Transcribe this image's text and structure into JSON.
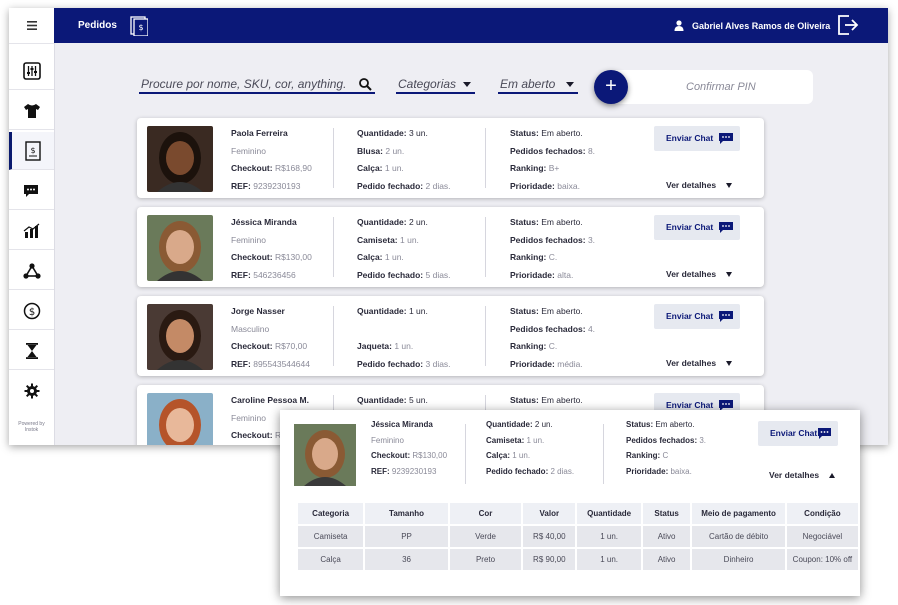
{
  "sidebar": {
    "items": [
      {
        "icon": "hamburger-menu-icon"
      },
      {
        "icon": "sliders-icon"
      },
      {
        "icon": "tshirt-icon"
      },
      {
        "icon": "order-receipt-icon",
        "active": true
      },
      {
        "icon": "chat-icon"
      },
      {
        "icon": "bar-chart-icon"
      },
      {
        "icon": "network-icon"
      },
      {
        "icon": "dollar-icon"
      },
      {
        "icon": "hourglass-icon"
      },
      {
        "icon": "gear-icon"
      }
    ],
    "powered_line1": "Powered by",
    "powered_line2": "Instok"
  },
  "header": {
    "title": "Pedidos",
    "user_name": "Gabriel Alves Ramos de Oliveira"
  },
  "filters": {
    "search_placeholder": "Procure por nome, SKU, cor, anything.",
    "category": "Categorias",
    "status": "Em aberto",
    "add_label": "+",
    "pin_label": "Confirmar PIN"
  },
  "orders": [
    {
      "name": "Paola Ferreira",
      "gender": "Feminino",
      "checkout_label": "Checkout:",
      "checkout": "R$168,90",
      "ref_label": "REF:",
      "ref": "9239230193",
      "qty_label": "Quantidade:",
      "qty": "3 un.",
      "line2_label": "Blusa:",
      "line2": "2 un.",
      "line3_label": "Calça:",
      "line3": "1 un.",
      "line4_label": "Pedido fechado:",
      "line4": "2 dias.",
      "status_label": "Status:",
      "status": "Em aberto.",
      "closed_label": "Pedidos fechados:",
      "closed": "8.",
      "ranking_label": "Ranking:",
      "ranking": "B+",
      "priority_label": "Prioridade:",
      "priority": "baixa.",
      "chat_label": "Enviar Chat",
      "details_label": "Ver detalhes",
      "skin": "#7a4a2e",
      "hair": "#1c120c",
      "bg": "#3a2a22"
    },
    {
      "name": "Jéssica Miranda",
      "gender": "Feminino",
      "checkout_label": "Checkout:",
      "checkout": "R$130,00",
      "ref_label": "REF:",
      "ref": "546236456",
      "qty_label": "Quantidade:",
      "qty": "2 un.",
      "line2_label": "Camiseta:",
      "line2": "1 un.",
      "line3_label": "Calça:",
      "line3": "1 un.",
      "line4_label": "Pedido fechado:",
      "line4": "5 dias.",
      "status_label": "Status:",
      "status": "Em aberto.",
      "closed_label": "Pedidos fechados:",
      "closed": "3.",
      "ranking_label": "Ranking:",
      "ranking": "C.",
      "priority_label": "Prioridade:",
      "priority": "alta.",
      "chat_label": "Enviar Chat",
      "details_label": "Ver detalhes",
      "skin": "#d9a98a",
      "hair": "#8a5a34",
      "bg": "#6a7a5a"
    },
    {
      "name": "Jorge Nasser",
      "gender": "Masculino",
      "checkout_label": "Checkout:",
      "checkout": "R$70,00",
      "ref_label": "REF:",
      "ref": "895543544644",
      "qty_label": "Quantidade:",
      "qty": "1 un.",
      "line2_label": "",
      "line2": "",
      "line3_label": "Jaqueta:",
      "line3": "1 un.",
      "line4_label": "Pedido fechado:",
      "line4": "3 dias.",
      "status_label": "Status:",
      "status": "Em aberto.",
      "closed_label": "Pedidos fechados:",
      "closed": "4.",
      "ranking_label": "Ranking:",
      "ranking": "C.",
      "priority_label": "Prioridade:",
      "priority": "média.",
      "chat_label": "Enviar Chat",
      "details_label": "Ver detalhes",
      "skin": "#c48a66",
      "hair": "#2a1a12",
      "bg": "#4a3a34"
    },
    {
      "name": "Caroline Pessoa M.",
      "gender": "Feminino",
      "checkout_label": "Checkout:",
      "checkout": "R$",
      "ref_label": "",
      "ref": "",
      "qty_label": "Quantidade:",
      "qty": "5 un.",
      "line2_label": "",
      "line2": "",
      "line3_label": "",
      "line3": "",
      "line4_label": "",
      "line4": "",
      "status_label": "Status:",
      "status": "Em aberto.",
      "closed_label": "",
      "closed": "",
      "ranking_label": "",
      "ranking": "",
      "priority_label": "",
      "priority": "",
      "chat_label": "Enviar Chat",
      "details_label": "",
      "skin": "#e8b89a",
      "hair": "#b5542a",
      "bg": "#8ab0c8"
    }
  ],
  "expanded": {
    "name": "Jéssica Miranda",
    "gender": "Feminino",
    "checkout_label": "Checkout:",
    "checkout": "R$130,00",
    "ref_label": "REF:",
    "ref": "9239230193",
    "qty_label": "Quantidade:",
    "qty": "2 un.",
    "line2_label": "Camiseta:",
    "line2": "1 un.",
    "line3_label": "Calça:",
    "line3": "1 un.",
    "line4_label": "Pedido fechado:",
    "line4": "2 dias.",
    "status_label": "Status:",
    "status": "Em aberto.",
    "closed_label": "Pedidos fechados:",
    "closed": "3.",
    "ranking_label": "Ranking:",
    "ranking": "C",
    "priority_label": "Prioridade:",
    "priority": "baixa.",
    "chat_label": "Enviar Chat",
    "details_label": "Ver detalhes",
    "table": {
      "headers": [
        "Categoria",
        "Tamanho",
        "Cor",
        "Valor",
        "Quantidade",
        "Status",
        "Meio de pagamento",
        "Condição"
      ],
      "rows": [
        [
          "Camiseta",
          "PP",
          "Verde",
          "R$ 40,00",
          "1 un.",
          "Ativo",
          "Cartão de débito",
          "Negociável"
        ],
        [
          "Calça",
          "36",
          "Preto",
          "R$ 90,00",
          "1 un.",
          "Ativo",
          "Dinheiro",
          "Coupon: 10% off"
        ]
      ]
    }
  },
  "colors": {
    "brand": "#0b1878",
    "background": "#eeeef3"
  }
}
